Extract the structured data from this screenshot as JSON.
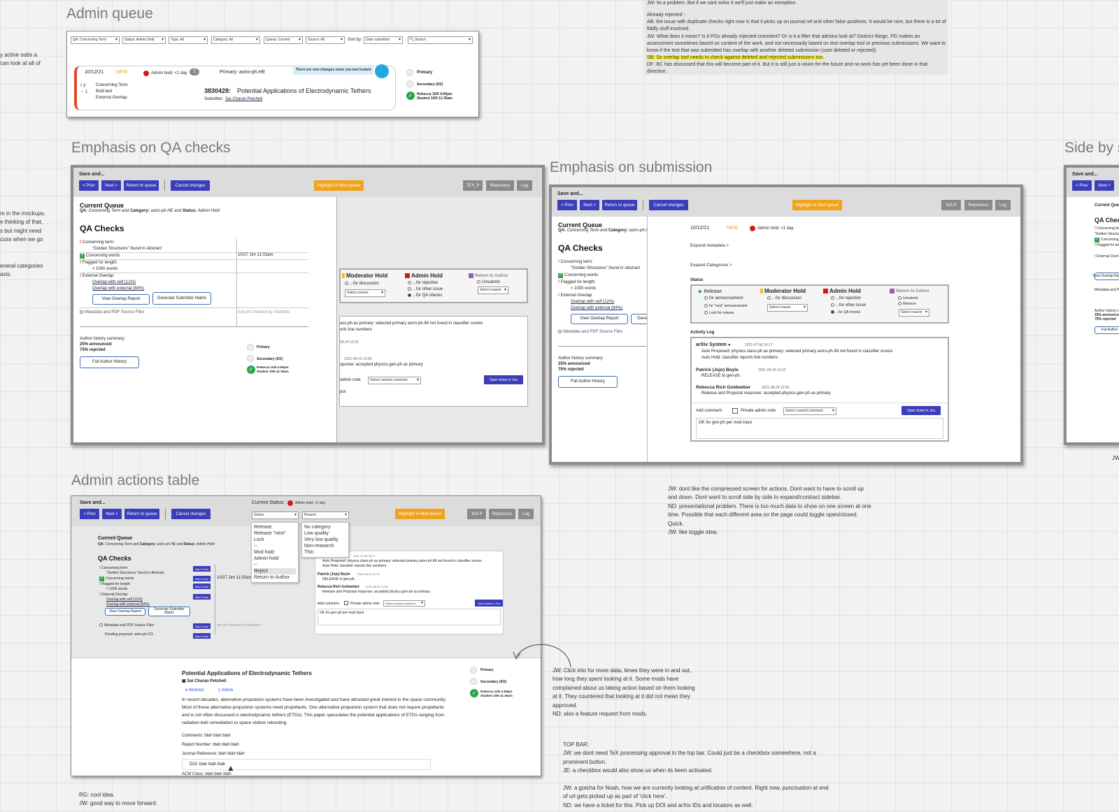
{
  "titles": {
    "admin_queue": "Admin queue",
    "qa_checks": "Emphasis on QA checks",
    "submission": "Emphasis on submission",
    "actions_table": "Admin actions table",
    "side": "Side by s"
  },
  "left_notes": [
    {
      "text": "y active subs a\ncan look at all of"
    },
    {
      "text": "m in the mockups.\ne thinking of that.\ns but might need\ncuss when we go"
    },
    {
      "text": "eneral categories\nasis."
    }
  ],
  "top_notes": {
    "line0": "JW: its a problem. But if we cant solve it we'll just make an exception.",
    "line1": "Already rejected -",
    "line2": "AB: the issue with duplicate checks right now is that it picks up on journal ref and other false positives. It would be nice, but there is a lot of fiddly stuff involved.",
    "line3": "JW: What does it mean? Is it PGs already rejected comment? Or is it a filter that admins look at? Distinct things. PG makes an assessment sometimes based on content of the work, and not necessarily based on text overlap tool or previous submissions. We want to know if the text that was submitted has overlap with another deleted submission (user deleted or rejected).",
    "line4": "SB: So overlap tool needs to check against deleted and rejected submissions too.",
    "line5": "DF: BC has discussed that this will become part of it. But it is still just a vision for the future and no work has yet been done in that direction."
  },
  "queue": {
    "filters": [
      "QA: Concerning Term",
      "Status: Admin Hold",
      "Type: All",
      "Category: All",
      "Queue: Current",
      "Source: All"
    ],
    "sort_label": "Sort by:",
    "sort_value": "Date submitted",
    "search_placeholder": "Search",
    "date": "10/12/21",
    "new": "NEW",
    "hold": "Admin hold: <1 day",
    "comments": "3",
    "primary": "Primary: astro-ph.HE",
    "tooltip": "There are new changes since you last looked",
    "flags": [
      {
        "n": "3",
        "label": "Concerning Term"
      },
      {
        "n": "1",
        "label": "Bold text"
      },
      {
        "n": "",
        "label": "External Overlap"
      }
    ],
    "id": "3830428:",
    "title": "Potential Applications of Electrodynamic Tethers",
    "submitter_label": "Submitter:",
    "submitter": "Sai Charan Petcheti",
    "checks": {
      "primary": "Primary",
      "secondary": "Secondary (0/2)",
      "rebecca": "Rebecca 10/5 4:56pm",
      "student": "Student 10/6 11:35am"
    }
  },
  "toolbar": {
    "save": "Save and...",
    "prev": "< Prev",
    "next": "Next >",
    "ret": "Return to queue",
    "cancel": "Cancel changes",
    "highlight": "Highlight in Mod queue",
    "tex": "TeX P",
    "tex2": "TEX_P",
    "reprocess": "Reprocess",
    "log": "Log"
  },
  "qa": {
    "current_queue": "Current Queue",
    "qa_line_prefix": "QA:",
    "qa_term": "Concerning Term",
    "and1": "and",
    "cat_label": "Category:",
    "cat": "astro-ph.HE",
    "and2": "and",
    "status_label": "Status:",
    "status": "Admin Hold",
    "heading": "QA Checks",
    "concerning_term": "Concerning term:",
    "golden": "\"Golden Structures\"",
    "found_in": "found in Abstract",
    "concerning_words": "Concerning words",
    "jim": "10/27 Jim 11:03am",
    "flagged": "Flagged for length:",
    "lt1000": "< 1000 words",
    "external": "External Overlap",
    "self": "Overlap with self (12%)",
    "ext": "Overlap with external (84%)",
    "view_overlap": "View Overlap Report",
    "gen_matrix": "Generate Submitter Matrix",
    "gen_matrix_short": "Gene",
    "metadata": "Metadata and PDF Source Files",
    "not_checked": "not yet checked by students",
    "author_summary": "Author history summary:",
    "announced": "25% announced",
    "rejected": "75% rejected",
    "full_history": "Full Author History",
    "pending": "Pending proposal: astro-ph.CO"
  },
  "status_panel": {
    "status": "Status",
    "release": "Release",
    "for_announcement": "for announcement",
    "next_announcement": "for \"next\" announcement",
    "lock": "Lock for release",
    "moderator_hold": "Moderator Hold",
    "for_discussion": "...for discussion",
    "select_reason": "Select reason",
    "admin_hold": "Admin Hold",
    "for_rejection": "...for rejection",
    "for_other": "...for other issue",
    "for_qa": "...for QA checks",
    "return_author": "Return to Author",
    "unsubmit": "Unsubmit",
    "remove": "Remove"
  },
  "activity": {
    "label": "Activity Log",
    "arxiv": "arXiv System",
    "arxiv_date": "2021-07-08 16:17",
    "auto_proposed": "Auto Proposed: physics.class-ph as primary: selected primary astro-ph.IM not found in classifier scores",
    "auto_hold": "Auto Hold: classifier reports line numbers",
    "patrick": "Patrick (Jojo) Boyle",
    "patrick_date": "2021-08-24 10:32",
    "release_gen": "RELEASE to gen-ph.",
    "rebecca": "Rebecca Rich Goldweber",
    "rebecca_date": "2021-08-24 12:56",
    "proposal": "Release and Proposal response: accepted physics.gen-ph as primary",
    "add_comment": "Add comment",
    "private": "Private admin note",
    "canned": "Select canned comment",
    "open_jira": "Open ticket in Jira",
    "input": "OK for gen-ph per mod input",
    "frag1": "ass-ph as primary: selected primary astro-ph.IM not found in classifier scores",
    "frag2": "orts line numbers",
    "frag3": "08-24 10:32",
    "frag4": "2021-08-24 12:56",
    "frag5": "sponse: accepted physics.gen-ph as primary",
    "frag6": "admin note",
    "frag7": "put"
  },
  "submission": {
    "expand_meta": "Expand metadata >",
    "expand_cats": "Expand Categories >",
    "date": "10/12/21",
    "new": "NEW",
    "hold": "Admin hold: <1 day"
  },
  "actions": {
    "current_status": "Current Status:",
    "hold": "Admin hold: <1 day",
    "status_sel": "Status",
    "reason_sel": "Reason",
    "status_opts": [
      "Release",
      "Release \"next\"",
      "Lock",
      "--",
      "Mod hold",
      "Admin-hold",
      "--",
      "Reject",
      "Return to Author"
    ],
    "reason_opts": [
      "No category",
      "Low quality",
      "Very low quality",
      "Non-research",
      "Thin"
    ],
    "qbtns": [
      "Mark Pend",
      "Mark Done",
      "Mark Done",
      "Mark Done",
      "Mark Done",
      "Mark Done"
    ],
    "paper_title": "Potential Applications of Electrodynamic Tethers",
    "author": "Sai Charan Petcheti",
    "abstract_tab": "Abstract",
    "article_tab": "Article",
    "abstract": "In recent decades, alternative propulsion systems have been investigated and have attracted great interest in the space community. Most of these alternative propulsion systems need propellants. One alternative propulsion system that does not require propellants and is not often discussed is electrodynamic tethers (ETDs). This paper speculates the potential applications of ETDs ranging from radiation belt remediation to space station rebooting.",
    "comments": "Comments: blah blah blah",
    "report": "Report Number: blah blah blah",
    "journal": "Journal Reference: blah blah blah",
    "doi": "DOI: blah blah blah",
    "acm": "ACM Class: blah blah blah"
  },
  "bottom_notes": {
    "jw_compressed": "JW: dont like the compressed screen for actions. Dont want to have to scroll up and down. Dont want to scroll side by side to expand/contract sidebar.\nND: presentational problem. There is too much data to show on one screen at one time. Possible that each different area on the page could toggle open/closed. Quick.\nJW: like toggle idea.",
    "jw_click": "JW: Click into for more data, times they were in and out, how long they spent looking at it. Some mods have complained about us taking action based on them looking at it. They countered that looking at it did not mean they approved.\nND: also a feature request from mods.",
    "top_bar": "TOP BAR:\nJW: we dont need TeX processing approval in the top bar. Could just be a checkbox somewhere, not a prominent button.\nJE: a checkbox would also show us when its been activated.\n\nJW: a gotcha for Noah, how we are currently looking at urlification of content. Right now, punctuation at end of url gets picked up as part of 'click here'.\nND: we have a ticket for this. Pick up DOI and arXiv IDs and locators as well.",
    "rg": "RG: cool idea.\nJW: good way to move forward.",
    "jw_edge": "JW"
  },
  "colors": {
    "primary_btn": "#3b3dbb",
    "highlight": "#f0a31a",
    "green": "#2aa44a",
    "red": "#d41a1a",
    "note_yellow": "#f7f234"
  }
}
